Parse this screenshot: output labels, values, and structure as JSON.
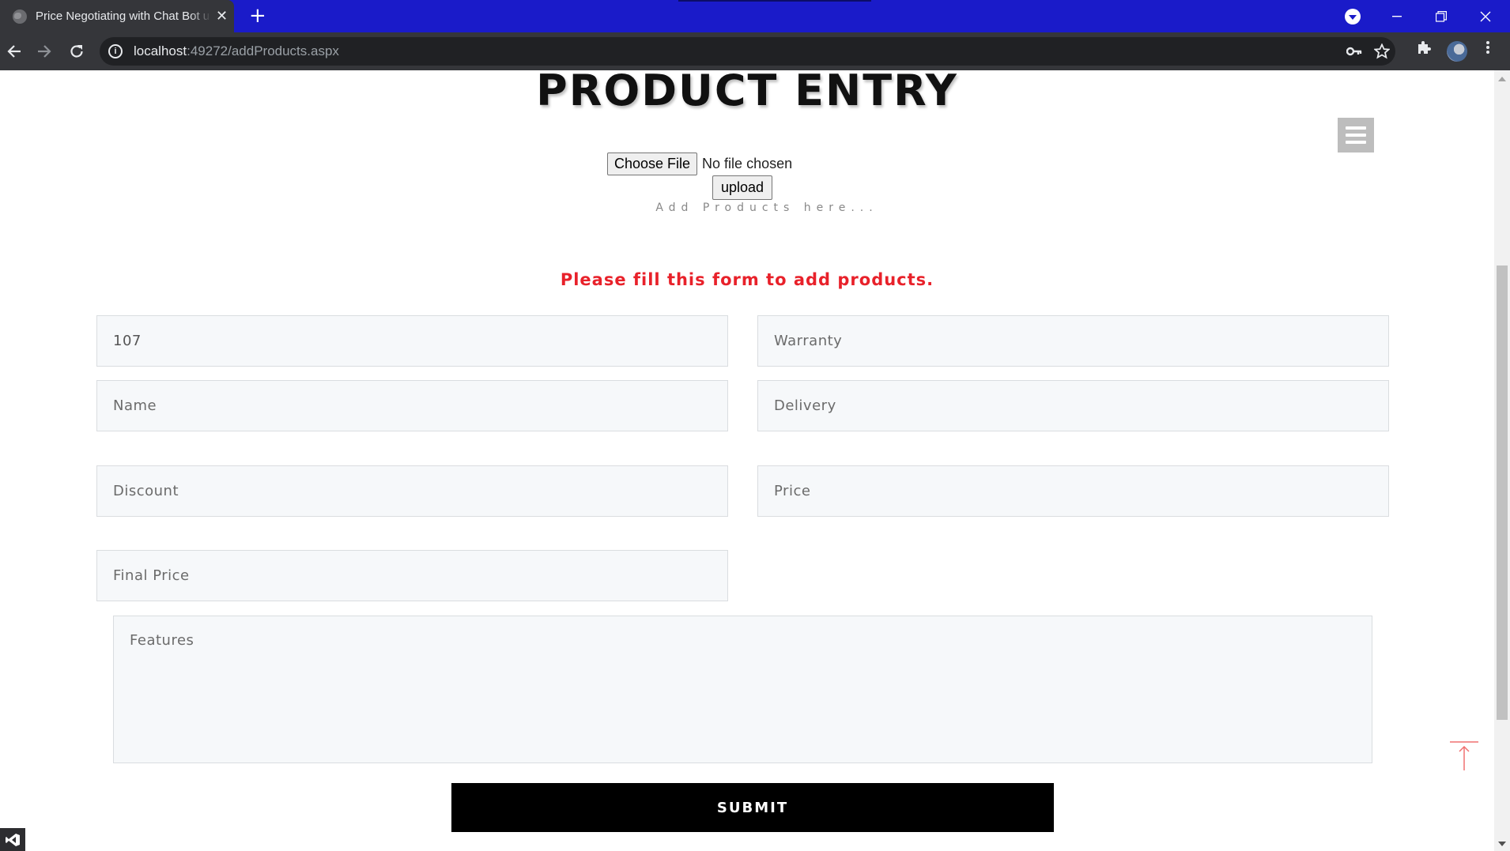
{
  "browser": {
    "tab_title": "Price Negotiating with Chat Bot u",
    "tab_close": "✕",
    "new_tab": "+",
    "url_host": "localhost",
    "url_rest": ":49272/addProducts.aspx",
    "icons": [
      "globe-icon",
      "back-arrow-icon",
      "forward-arrow-icon",
      "reload-icon",
      "info-icon",
      "key-icon",
      "star-icon",
      "extensions-icon",
      "more-vert-icon",
      "minimize-icon",
      "restore-icon",
      "close-icon"
    ]
  },
  "page": {
    "title": "PRODUCT ENTRY",
    "choose_file_label": "Choose File",
    "file_status": "No file chosen",
    "upload_label": "upload",
    "subtitle": "Add Products here...",
    "form_heading": "Please fill this form to add products.",
    "accent_color": "#e8212a"
  },
  "form": {
    "product_id_value": "107",
    "warranty_placeholder": "Warranty",
    "name_placeholder": "Name",
    "delivery_placeholder": "Delivery",
    "discount_placeholder": "Discount",
    "price_placeholder": "Price",
    "final_price_placeholder": "Final Price",
    "features_placeholder": "Features",
    "submit_label": "SUBMIT"
  }
}
